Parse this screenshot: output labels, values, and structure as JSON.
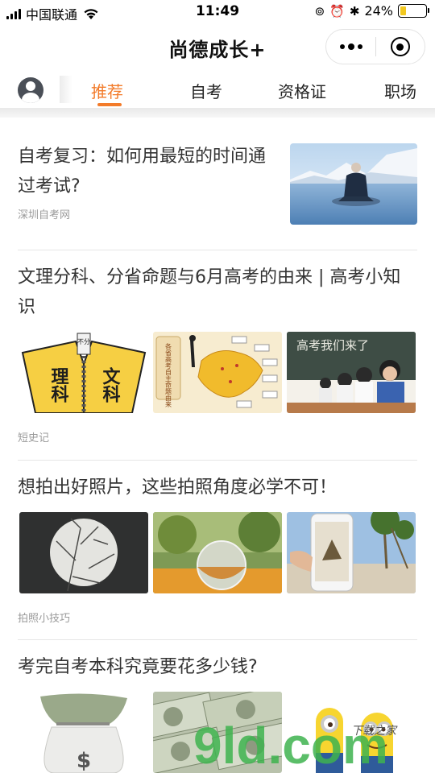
{
  "status_bar": {
    "carrier": "中国联通",
    "time": "11:49",
    "battery_percent": "24%",
    "battery_level": 0.24
  },
  "nav": {
    "title": "尚德成长+"
  },
  "tabs": [
    {
      "label": "推荐",
      "active": true
    },
    {
      "label": "自考",
      "active": false
    },
    {
      "label": "资格证",
      "active": false
    },
    {
      "label": "职场",
      "active": false
    }
  ],
  "articles": [
    {
      "title": "自考复习：如何用最短的时间通过考试?",
      "source": "深圳自考网"
    },
    {
      "title": "文理分科、分省命题与6月高考的由来 | 高考小知识",
      "source": "短史记"
    },
    {
      "title": "想拍出好照片，这些拍照角度必学不可！",
      "source": "拍照小技巧"
    },
    {
      "title": "考完自考本科究竟要花多少钱?",
      "source": ""
    }
  ],
  "image_text": {
    "zipper_small": "不分",
    "zipper_left": "理科",
    "zipper_right": "文科",
    "map_caption": "各省高考自主命题由来",
    "chalkboard": "高考我们来了"
  },
  "watermark": {
    "text": "9ld.com",
    "script": "下载之家"
  },
  "colors": {
    "accent": "#f37b2a",
    "battery": "#f2c81f",
    "watermark_green": "#3fb34f",
    "watermark_orange": "#f39a1e"
  }
}
